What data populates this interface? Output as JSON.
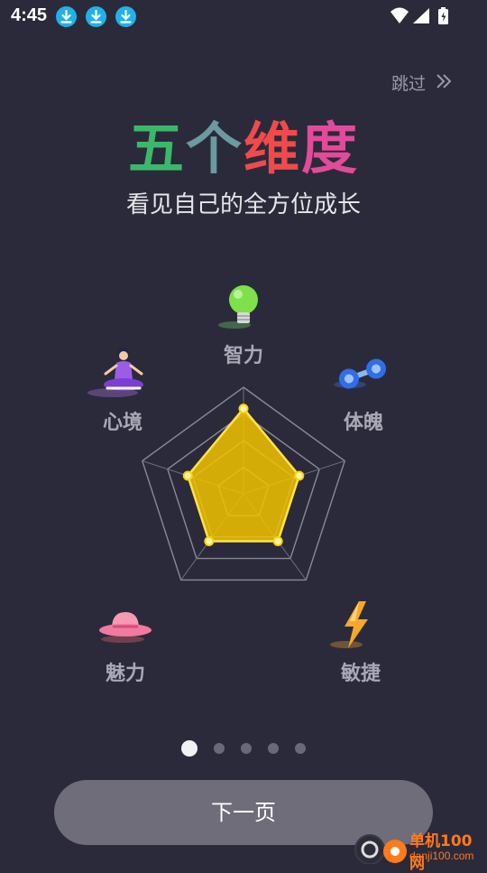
{
  "status_bar": {
    "time": "4:45",
    "notification_icons": [
      "download-icon",
      "download-icon",
      "download-icon"
    ],
    "right_icons": [
      "wifi-icon",
      "signal-icon",
      "battery-charging-icon"
    ]
  },
  "skip_label": "跳过",
  "title": {
    "chars": [
      "五",
      "个",
      "维",
      "度"
    ],
    "colors": [
      "#3bb86a",
      "#6b9aa0",
      "#f04a4a",
      "#e04b9a"
    ]
  },
  "subtitle": "看见自己的全方位成长",
  "dimensions": [
    {
      "label": "智力",
      "icon": "lightbulb-icon"
    },
    {
      "label": "心境",
      "icon": "meditation-icon"
    },
    {
      "label": "体魄",
      "icon": "dumbbell-icon"
    },
    {
      "label": "魅力",
      "icon": "hat-icon"
    },
    {
      "label": "敏捷",
      "icon": "lightning-icon"
    }
  ],
  "radar": {
    "levels": 4,
    "values": [
      0.8,
      0.55,
      0.55,
      0.55,
      0.55
    ]
  },
  "pager": {
    "count": 5,
    "active_index": 0
  },
  "next_button": "下一页",
  "watermark": {
    "name": "单机100网",
    "domain": "danji100.com"
  },
  "colors": {
    "background": "#2b2a3a",
    "radar_fill": "#f2c300",
    "accent_blue": "#1fb1ea"
  }
}
